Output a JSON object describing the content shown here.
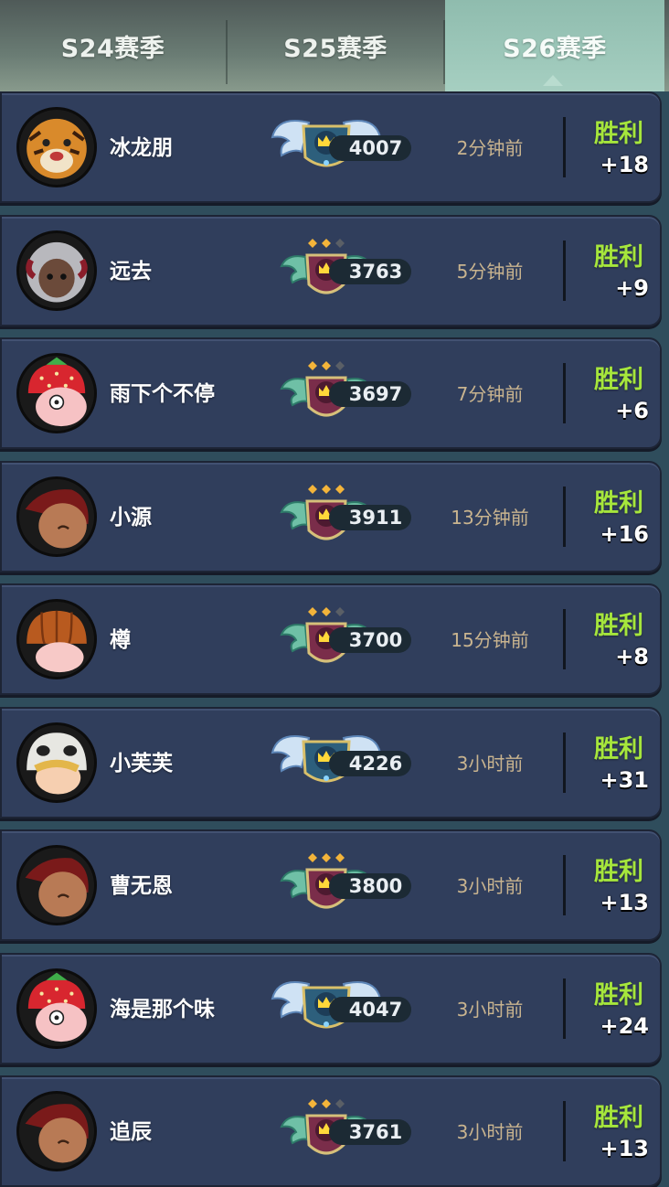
{
  "tabs": [
    {
      "label": "S24赛季",
      "selected": false
    },
    {
      "label": "S25赛季",
      "selected": false
    },
    {
      "label": "S26赛季",
      "selected": true
    }
  ],
  "colors": {
    "win": "#a6e63c",
    "time": "#c9b48f",
    "card": "#303e5c"
  },
  "matches": [
    {
      "name": "冰龙朋",
      "avatar": "tiger-avatar",
      "rank_icon": "winged-crown-badge",
      "score": "4007",
      "time": "2分钟前",
      "result": "胜利",
      "delta": "+18"
    },
    {
      "name": "远去",
      "avatar": "goat-girl-avatar",
      "rank_icon": "crown-badge-2-stars",
      "score": "3763",
      "time": "5分钟前",
      "result": "胜利",
      "delta": "+9"
    },
    {
      "name": "雨下个不停",
      "avatar": "strawberry-avatar",
      "rank_icon": "crown-badge-2-stars",
      "score": "3697",
      "time": "7分钟前",
      "result": "胜利",
      "delta": "+6"
    },
    {
      "name": "小源",
      "avatar": "bald-avatar",
      "rank_icon": "crown-badge-3-stars",
      "score": "3911",
      "time": "13分钟前",
      "result": "胜利",
      "delta": "+16"
    },
    {
      "name": "樽",
      "avatar": "pumpkin-avatar",
      "rank_icon": "crown-badge-2-stars",
      "score": "3700",
      "time": "15分钟前",
      "result": "胜利",
      "delta": "+8"
    },
    {
      "name": "小芙芙",
      "avatar": "panda-hood-avatar",
      "rank_icon": "winged-crown-badge",
      "score": "4226",
      "time": "3小时前",
      "result": "胜利",
      "delta": "+31"
    },
    {
      "name": "曹无恩",
      "avatar": "bald-avatar",
      "rank_icon": "crown-badge-3-stars",
      "score": "3800",
      "time": "3小时前",
      "result": "胜利",
      "delta": "+13"
    },
    {
      "name": "海是那个味",
      "avatar": "strawberry-avatar",
      "rank_icon": "winged-crown-badge",
      "score": "4047",
      "time": "3小时前",
      "result": "胜利",
      "delta": "+24"
    },
    {
      "name": "追辰",
      "avatar": "bald-avatar",
      "rank_icon": "crown-badge-2-stars",
      "score": "3761",
      "time": "3小时前",
      "result": "胜利",
      "delta": "+13"
    }
  ]
}
